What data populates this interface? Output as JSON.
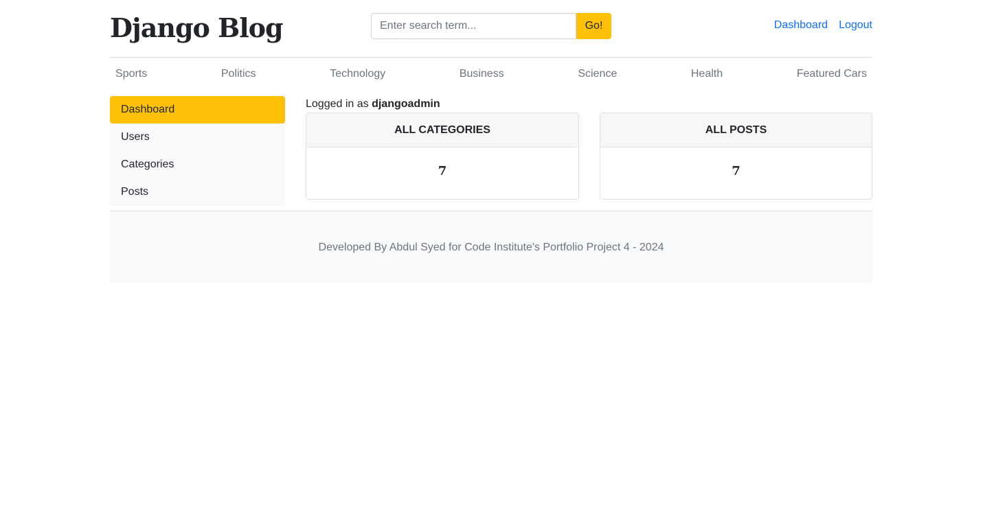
{
  "header": {
    "brand": "Django Blog",
    "search_placeholder": "Enter search term...",
    "search_button": "Go!",
    "links": [
      "Dashboard",
      "Logout"
    ]
  },
  "categories": [
    "Sports",
    "Politics",
    "Technology",
    "Business",
    "Science",
    "Health",
    "Featured Cars"
  ],
  "sidebar": {
    "items": [
      "Dashboard",
      "Users",
      "Categories",
      "Posts"
    ],
    "active": "Dashboard"
  },
  "main": {
    "logged_in_prefix": "Logged in as",
    "username": "djangoadmin",
    "cards": [
      {
        "title": "ALL CATEGORIES",
        "value": "7"
      },
      {
        "title": "ALL POSTS",
        "value": "7"
      }
    ]
  },
  "footer": {
    "text": "Developed By Abdul Syed for Code Institute's Portfolio Project 4 - 2024"
  },
  "colors": {
    "accent": "#ffc107",
    "link": "#0d6efd",
    "muted": "#6c757d"
  }
}
